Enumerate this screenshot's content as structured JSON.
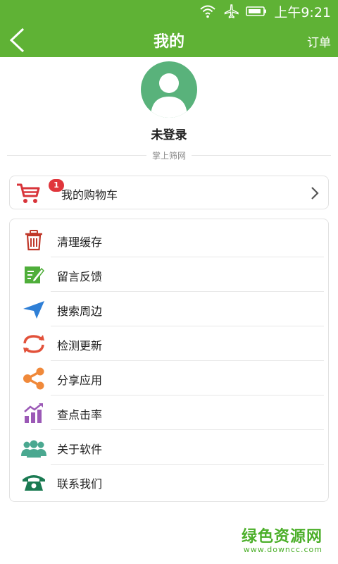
{
  "status_bar": {
    "time": "上午9:21",
    "wifi_icon": "wifi-icon",
    "airplane_icon": "airplane-icon",
    "battery_icon": "battery-icon"
  },
  "navbar": {
    "title": "我的",
    "right_action": "订单",
    "back_icon": "back-chevron-icon"
  },
  "profile": {
    "avatar_icon": "user-avatar-icon",
    "login_status": "未登录",
    "site_name": "掌上筛网"
  },
  "cart": {
    "label": "我的购物车",
    "badge_count": "1",
    "icon": "shopping-cart-icon",
    "arrow_icon": "chevron-right-icon"
  },
  "menu": {
    "items": [
      {
        "label": "清理缓存",
        "icon": "trash-icon"
      },
      {
        "label": "留言反馈",
        "icon": "edit-note-icon"
      },
      {
        "label": "搜索周边",
        "icon": "location-arrow-icon"
      },
      {
        "label": "检测更新",
        "icon": "refresh-icon"
      },
      {
        "label": "分享应用",
        "icon": "share-icon"
      },
      {
        "label": "查点击率",
        "icon": "stats-chart-icon"
      },
      {
        "label": "关于软件",
        "icon": "people-icon"
      },
      {
        "label": "联系我们",
        "icon": "phone-icon"
      }
    ]
  },
  "watermark": {
    "main": "绿色资源网",
    "sub": "www.downcc.com"
  },
  "colors": {
    "brand_green": "#5fb235",
    "avatar_green": "#59b27b",
    "badge_red": "#e0353b"
  }
}
